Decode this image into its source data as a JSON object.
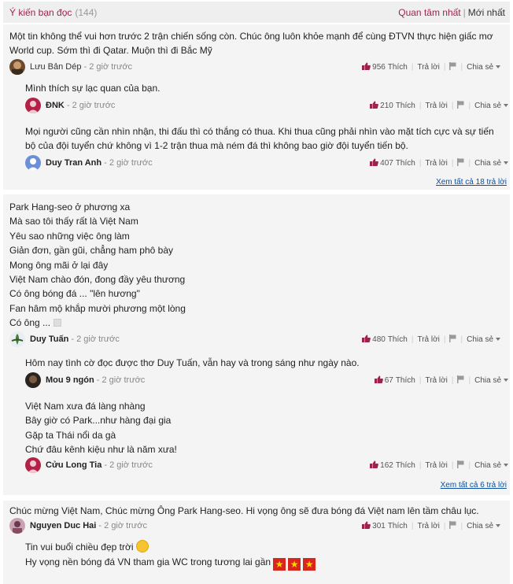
{
  "header": {
    "title": "Ý kiến bạn đọc",
    "count": "(144)",
    "sort_active": "Quan tâm nhất",
    "sort_sep": "|",
    "sort_other": "Mới nhất"
  },
  "actions_labels": {
    "like": "Thích",
    "reply": "Trả lời",
    "share": "Chia sẻ"
  },
  "comments": [
    {
      "text_lines": [
        "Một tin không thể vui hơn trước 2 trận chiến sống còn. Chúc ông luôn khỏe mạnh để cùng ĐTVN thực hiện giấc mơ",
        "World cup. Sớm thì đi Qatar. Muộn thì đi Bắc Mỹ"
      ],
      "author": "Lưu Bản Dép",
      "time": "- 2 giờ trước",
      "likes": "956",
      "replies": [
        {
          "text_lines": [
            "Mình thích sự lạc quan của bạn."
          ],
          "author": "ĐNK",
          "time": "- 2 giờ trước",
          "likes": "210"
        },
        {
          "text_lines": [
            "Mọi người cũng cần nhìn nhận, thi đấu thì có thắng có thua. Khi thua cũng phải nhìn vào mặt tích cực và sự tiến",
            "bộ của đội tuyển chứ không vì 1-2 trận thua mà ném đá thì không bao giờ đội tuyển tiến bộ."
          ],
          "author": "Duy Tran Anh",
          "time": "- 2 giờ trước",
          "likes": "407"
        }
      ],
      "more_replies": "Xem tất cả 18 trả lời"
    },
    {
      "text_lines": [
        "Park Hang-seo ở phương xa",
        "Mà sao tôi thấy rất là Việt Nam",
        "Yêu sao những việc ông làm",
        "Giản đơn, gần gũi, chẳng ham phô bày",
        "Mong ông mãi ở lại đây",
        "Việt Nam chào đón, đong đầy yêu thương",
        "Có ông bóng đá ... \"lên hương\"",
        "Fan hâm mộ khắp mười phương một lòng",
        "Có ông ..."
      ],
      "author": "Duy Tuấn",
      "time": "- 2 giờ trước",
      "likes": "480",
      "replies": [
        {
          "text_lines": [
            "Hôm nay tình cờ đọc được thơ Duy Tuấn, vẫn hay và trong sáng như ngày nào."
          ],
          "author": "Mou 9 ngón",
          "time": "- 2 giờ trước",
          "likes": "67"
        },
        {
          "text_lines": [
            "Việt Nam xưa đá làng nhàng",
            "Bây giờ có Park...như hàng đại gia",
            "Gặp ta Thái nổi da gà",
            "Chứ đâu kênh kiệu như là năm xưa!"
          ],
          "author": "Cửu Long Tia",
          "time": "- 2 giờ trước",
          "likes": "162"
        }
      ],
      "more_replies": "Xem tất cả 6 trả lời"
    },
    {
      "text_lines": [
        "Chúc mừng Việt Nam, Chúc mừng Ông Park Hang-seo. Hi vọng ông sẽ đưa bóng đá Việt nam lên tầm châu lục."
      ],
      "author": "Nguyen Duc Hai",
      "time": "- 2 giờ trước",
      "likes": "301",
      "replies": [
        {
          "text_lines": [
            "Tin vui buổi chiều đẹp trời",
            "Hy vọng nền bóng đá VN tham gia WC trong tương lai gần"
          ]
        }
      ]
    }
  ],
  "colors": {
    "accent": "#9f224e",
    "link": "#0b4fa0",
    "block_bg": "#f4f4f4"
  }
}
